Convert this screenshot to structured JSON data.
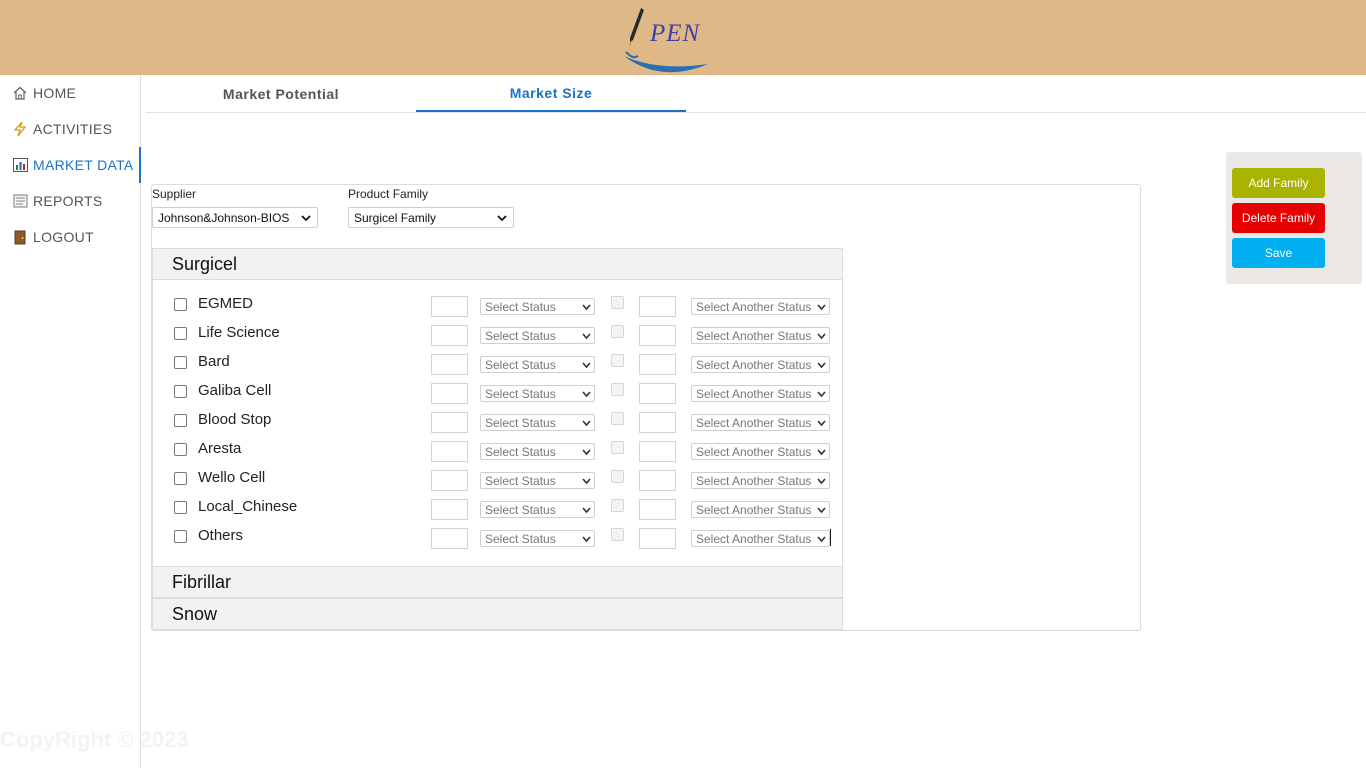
{
  "header": {
    "logo_text": "PEN"
  },
  "sidebar": {
    "items": [
      {
        "label": "HOME",
        "icon": "home-icon"
      },
      {
        "label": "ACTIVITIES",
        "icon": "lightning-icon"
      },
      {
        "label": "MARKET DATA",
        "icon": "bar-chart-icon",
        "active": true
      },
      {
        "label": "REPORTS",
        "icon": "document-icon"
      },
      {
        "label": "LOGOUT",
        "icon": "door-icon"
      }
    ],
    "copyright": "CopyRight © 2023"
  },
  "tabs": [
    {
      "label": "Market Potential",
      "active": false
    },
    {
      "label": "Market Size",
      "active": true
    }
  ],
  "filters": {
    "supplier_label": "Supplier",
    "supplier_value": "Johnson&Johnson-BIOS",
    "family_label": "Product Family",
    "family_value": "Surgicel Family"
  },
  "families": [
    {
      "name": "Surgicel",
      "expanded": true,
      "products": [
        {
          "name": "EGMED",
          "status": "Select Status",
          "another_status": "Select Another Status"
        },
        {
          "name": "Life Science",
          "status": "Select Status",
          "another_status": "Select Another Status"
        },
        {
          "name": "Bard",
          "status": "Select Status",
          "another_status": "Select Another Status"
        },
        {
          "name": "Galiba Cell",
          "status": "Select Status",
          "another_status": "Select Another Status"
        },
        {
          "name": "Blood Stop",
          "status": "Select Status",
          "another_status": "Select Another Status"
        },
        {
          "name": "Aresta",
          "status": "Select Status",
          "another_status": "Select Another Status"
        },
        {
          "name": "Wello Cell",
          "status": "Select Status",
          "another_status": "Select Another Status"
        },
        {
          "name": "Local_Chinese",
          "status": "Select Status",
          "another_status": "Select Another Status"
        },
        {
          "name": "Others",
          "status": "Select Status",
          "another_status": "Select Another Status"
        }
      ]
    },
    {
      "name": "Fibrillar",
      "expanded": false
    },
    {
      "name": "Snow",
      "expanded": false
    }
  ],
  "actions": {
    "add_label": "Add Family",
    "delete_label": "Delete Family",
    "save_label": "Save",
    "colors": {
      "add": "#a9b300",
      "delete": "#e60000",
      "save": "#00b0f0"
    }
  },
  "theme": {
    "header_bg": "#deb887",
    "accent": "#1a73c9"
  }
}
